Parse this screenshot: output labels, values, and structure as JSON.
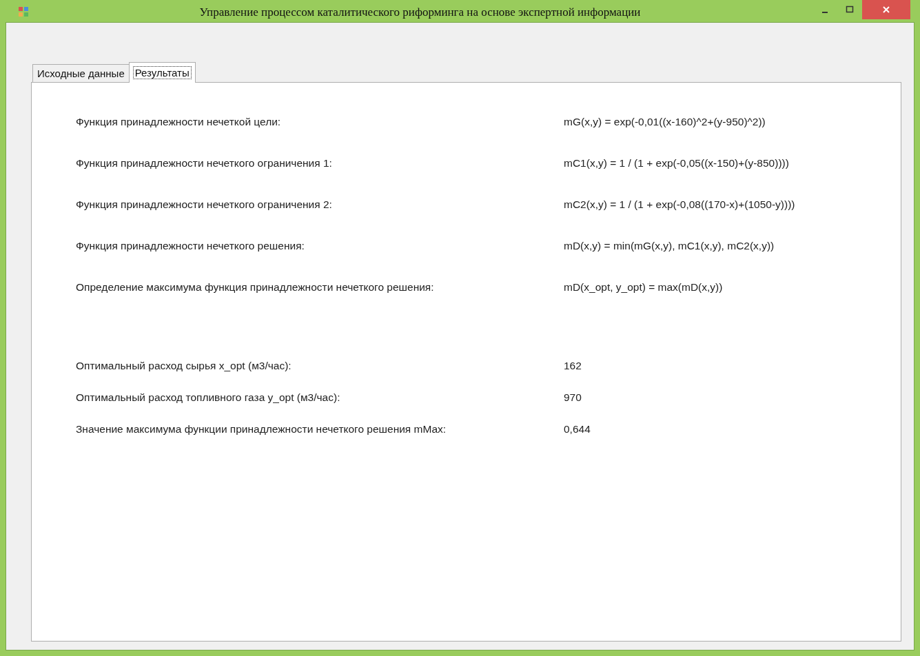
{
  "window": {
    "title": "Управление процессом каталитического риформинга на основе экспертной информации"
  },
  "tabs": [
    {
      "label": "Исходные данные",
      "selected": false
    },
    {
      "label": "Результаты",
      "selected": true
    }
  ],
  "formulas": [
    {
      "label": "Функция принадлежности нечеткой цели:",
      "value": "mG(x,y) = exp(-0,01((x-160)^2+(y-950)^2))"
    },
    {
      "label": "Функция принадлежности нечеткого ограничения 1:",
      "value": "mC1(x,y) = 1 / (1 + exp(-0,05((x-150)+(y-850))))"
    },
    {
      "label": "Функция принадлежности нечеткого ограничения 2:",
      "value": "mC2(x,y) = 1 / (1 + exp(-0,08((170-x)+(1050-y))))"
    },
    {
      "label": "Функция принадлежности нечеткого решения:",
      "value": "mD(x,y) = min(mG(x,y), mC1(x,y), mC2(x,y))"
    },
    {
      "label": "Определение максимума функция принадлежности нечеткого решения:",
      "value": "mD(x_opt, y_opt) = max(mD(x,y))"
    }
  ],
  "results": [
    {
      "label": "Оптимальный расход сырья x_opt (м3/час):",
      "value": "162"
    },
    {
      "label": "Оптимальный расход топливного газа y_opt (м3/час):",
      "value": "970"
    },
    {
      "label": "Значение максимума функции принадлежности нечеткого решения mMax:",
      "value": "0,644"
    }
  ]
}
